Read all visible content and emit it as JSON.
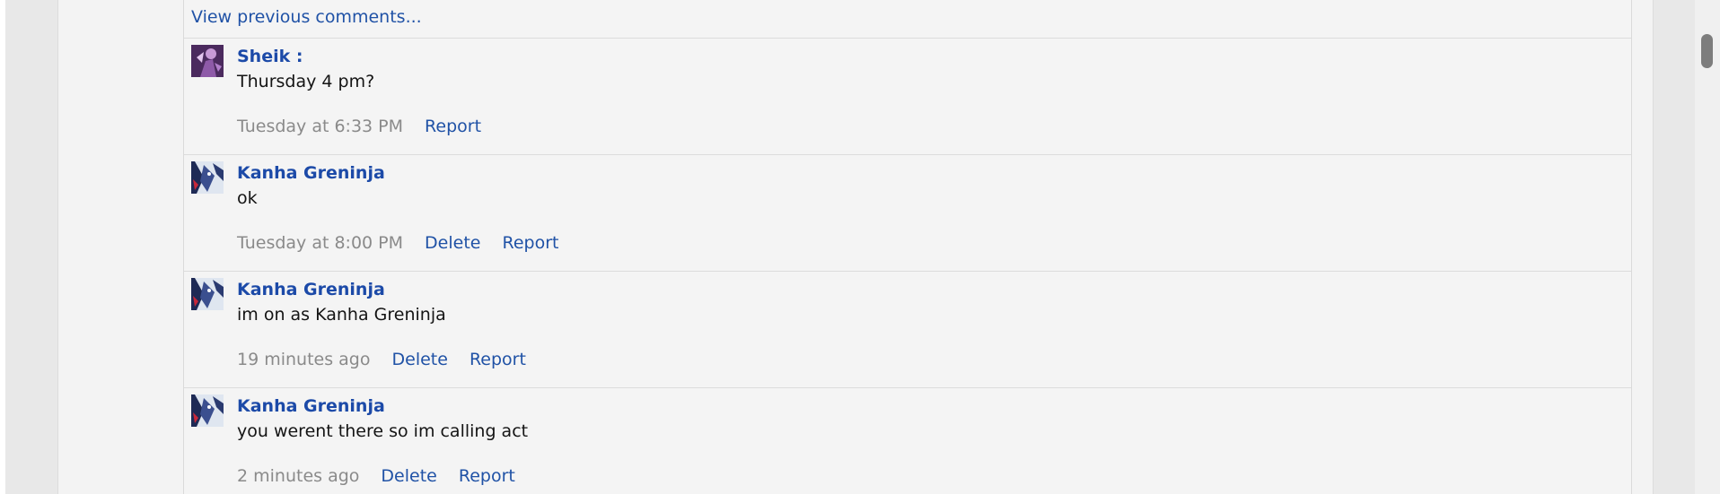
{
  "view_previous_label": "View previous comments...",
  "comments": [
    {
      "author": "Sheik :",
      "text": "Thursday 4 pm?",
      "time": "Tuesday at 6:33 PM",
      "report_label": "Report",
      "avatar": "avatar-sheik"
    },
    {
      "author": "Kanha Greninja",
      "text": "ok",
      "time": "Tuesday at 8:00 PM",
      "delete_label": "Delete",
      "report_label": "Report",
      "avatar": "avatar-greninja"
    },
    {
      "author": "Kanha Greninja",
      "text": "im on as Kanha Greninja",
      "time": "19 minutes ago",
      "delete_label": "Delete",
      "report_label": "Report",
      "avatar": "avatar-greninja"
    },
    {
      "author": "Kanha Greninja",
      "text": "you werent there so im calling act",
      "time": "2 minutes ago",
      "delete_label": "Delete",
      "report_label": "Report",
      "avatar": "avatar-greninja"
    }
  ],
  "colors": {
    "link": "#2052a6",
    "author": "#1c4aa8",
    "timestamp": "#8a8a8a",
    "background": "#f4f4f4"
  }
}
